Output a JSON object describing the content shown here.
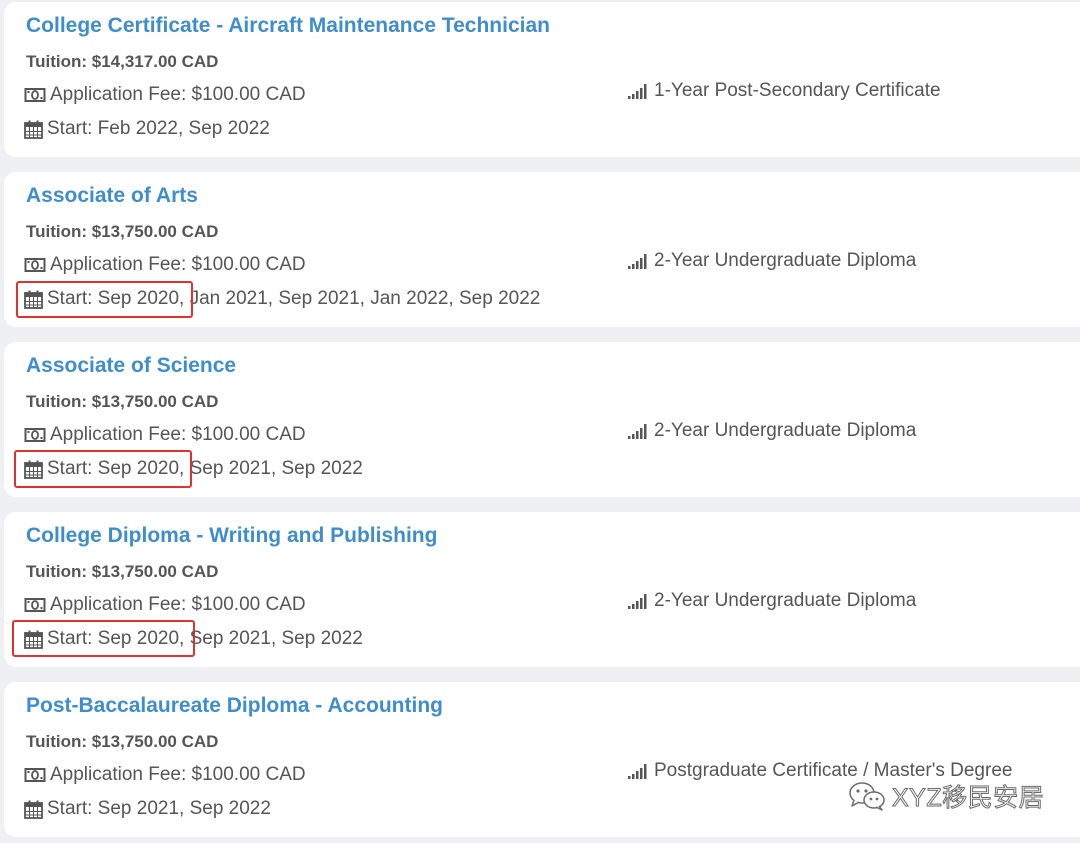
{
  "programs": [
    {
      "title": "College Certificate - Aircraft Maintenance Technician",
      "tuition": "Tuition: $14,317.00 CAD",
      "application_fee": "Application Fee: $100.00 CAD",
      "start": "Start: Feb 2022, Sep 2022",
      "level": "1-Year Post-Secondary Certificate",
      "highlighted": false
    },
    {
      "title": "Associate of Arts",
      "tuition": "Tuition: $13,750.00 CAD",
      "application_fee": "Application Fee: $100.00 CAD",
      "start": "Start: Sep 2020, Jan 2021, Sep 2021, Jan 2022, Sep 2022",
      "level": "2-Year Undergraduate Diploma",
      "highlighted": true
    },
    {
      "title": "Associate of Science",
      "tuition": "Tuition: $13,750.00 CAD",
      "application_fee": "Application Fee: $100.00 CAD",
      "start": "Start: Sep 2020, Sep 2021, Sep 2022",
      "level": "2-Year Undergraduate Diploma",
      "highlighted": true
    },
    {
      "title": "College Diploma - Writing and Publishing",
      "tuition": "Tuition: $13,750.00 CAD",
      "application_fee": "Application Fee: $100.00 CAD",
      "start": "Start: Sep 2020, Sep 2021, Sep 2022",
      "level": "2-Year Undergraduate Diploma",
      "highlighted": true
    },
    {
      "title": "Post-Baccalaureate Diploma - Accounting",
      "tuition": "Tuition: $13,750.00 CAD",
      "application_fee": "Application Fee: $100.00 CAD",
      "start": "Start: Sep 2021, Sep 2022",
      "level": "Postgraduate Certificate / Master's Degree",
      "highlighted": false
    }
  ],
  "icons": {
    "fee": "money-bill-icon",
    "start": "calendar-icon",
    "level": "signal-bars-icon",
    "watermark": "wechat-icon"
  },
  "watermark": {
    "text": "XYZ移民安居"
  },
  "colors": {
    "title": "#3e8ecf",
    "text": "#555555",
    "highlight_border": "#e0322c",
    "card_background": "#ffffff",
    "page_background": "#eef0f3"
  }
}
